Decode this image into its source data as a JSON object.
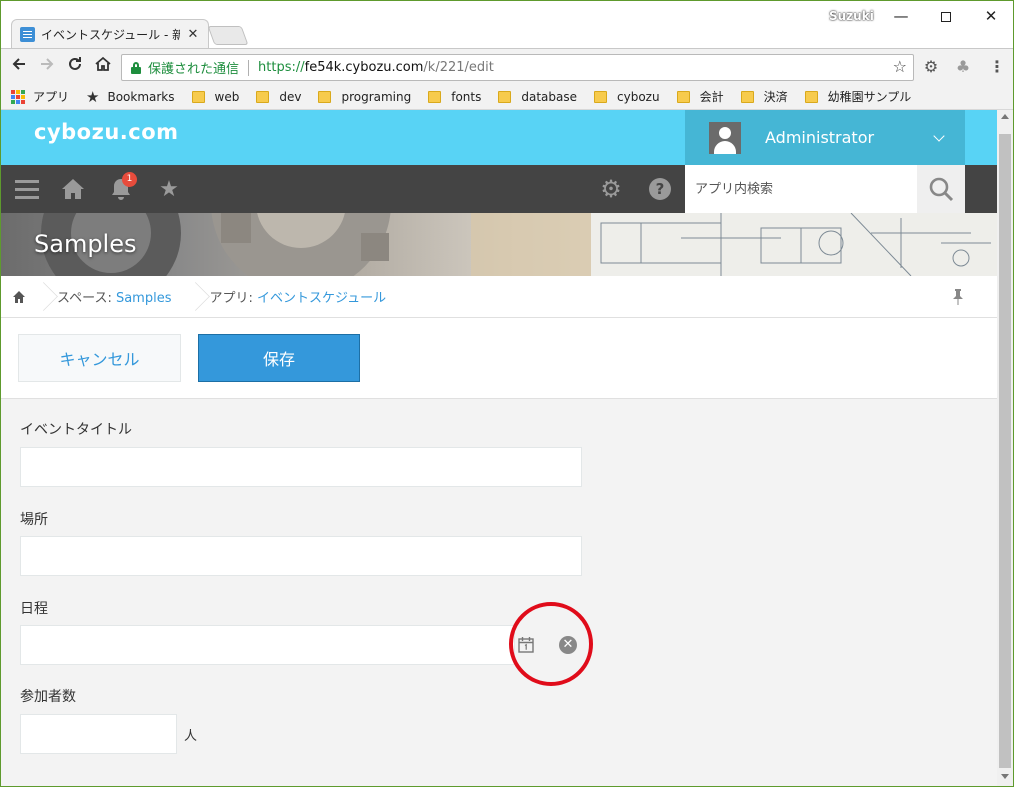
{
  "browser": {
    "tab_title": "イベントスケジュール - 新しい",
    "tab_close": "✕",
    "profile_name": "Suzuki",
    "window_controls": {
      "minimize": "—",
      "close": "✕"
    },
    "secure_label": "保護された通信",
    "url_scheme": "https://",
    "url_host": "fe54k.cybozu.com",
    "url_path": "/k/221/edit",
    "bookmarks": [
      {
        "label": "アプリ",
        "icon": "apps-grid-icon"
      },
      {
        "label": "Bookmarks",
        "icon": "star-icon"
      },
      {
        "label": "web",
        "icon": "folder-icon"
      },
      {
        "label": "dev",
        "icon": "folder-icon"
      },
      {
        "label": "programing",
        "icon": "folder-icon"
      },
      {
        "label": "fonts",
        "icon": "folder-icon"
      },
      {
        "label": "database",
        "icon": "folder-icon"
      },
      {
        "label": "cybozu",
        "icon": "folder-icon"
      },
      {
        "label": "会計",
        "icon": "folder-icon"
      },
      {
        "label": "決済",
        "icon": "folder-icon"
      },
      {
        "label": "幼稚園サンプル",
        "icon": "folder-icon"
      }
    ]
  },
  "header": {
    "logo": "cybozu.com",
    "user_name": "Administrator",
    "notification_count": "1",
    "search_placeholder": "アプリ内検索"
  },
  "banner": {
    "title": "Samples"
  },
  "breadcrumb": {
    "space_prefix": "スペース: ",
    "space_name": "Samples",
    "app_prefix": "アプリ: ",
    "app_name": "イベントスケジュール"
  },
  "actions": {
    "cancel_label": "キャンセル",
    "save_label": "保存"
  },
  "form": {
    "fields": {
      "title_label": "イベントタイトル",
      "title_value": "",
      "place_label": "場所",
      "place_value": "",
      "date_label": "日程",
      "date_value": "",
      "count_label": "参加者数",
      "count_value": "",
      "count_unit": "人"
    }
  },
  "colors": {
    "header_bg": "#58d3f5",
    "user_menu_bg": "#45b6d5",
    "nav_bg": "#444444",
    "accent": "#3498db",
    "highlight": "#e00c1a"
  }
}
